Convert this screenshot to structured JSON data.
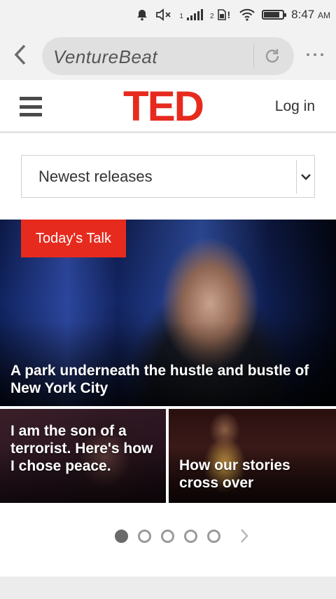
{
  "status_bar": {
    "sim1_label": "1",
    "sim2_label": "2",
    "sim2_alert": "!",
    "time": "8:47",
    "ampm": "AM"
  },
  "browser": {
    "url_text": "VentureBeat",
    "icons": [
      "back-arrow-icon",
      "reload-icon",
      "more-icon"
    ]
  },
  "header": {
    "logo": "TED",
    "login_label": "Log in",
    "brand_color": "#e62b1e"
  },
  "filter": {
    "selected": "Newest releases"
  },
  "hero": {
    "tag": "Today's Talk",
    "title": "A park underneath the hustle and bustle of New York City"
  },
  "tiles": [
    {
      "title": "I am the son of a terrorist. Here's how I chose peace."
    },
    {
      "title": "How our stories cross over"
    }
  ],
  "pagination": {
    "pages": 5,
    "active_page": 1
  }
}
